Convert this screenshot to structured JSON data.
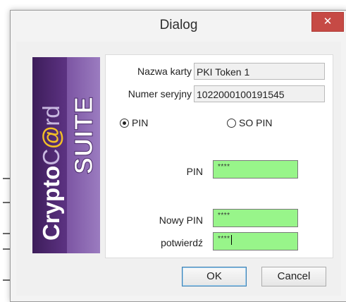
{
  "window": {
    "title": "Dialog",
    "close_glyph": "✕"
  },
  "logo": {
    "brand_prefix": "Crypto",
    "brand_c": "C",
    "brand_at": "@",
    "brand_rd": "rd",
    "suite": "SUITE",
    "colors": {
      "purple_dark": "#3d1d5a",
      "purple_light": "#9b7cc0",
      "accent": "#f3c026"
    }
  },
  "card": {
    "name_label": "Nazwa karty",
    "name_value": "PKI Token 1",
    "serial_label": "Numer seryjny",
    "serial_value": "1022000100191545"
  },
  "mode": {
    "pin_label": "PIN",
    "so_pin_label": "SO PIN",
    "selected": "PIN"
  },
  "fields": {
    "pin_label": "PIN",
    "pin_value": "****",
    "new_pin_label": "Nowy PIN",
    "new_pin_value": "****",
    "confirm_label": "potwierdź",
    "confirm_value": "****",
    "field_color": "#98f58a"
  },
  "buttons": {
    "ok": "OK",
    "cancel": "Cancel"
  }
}
